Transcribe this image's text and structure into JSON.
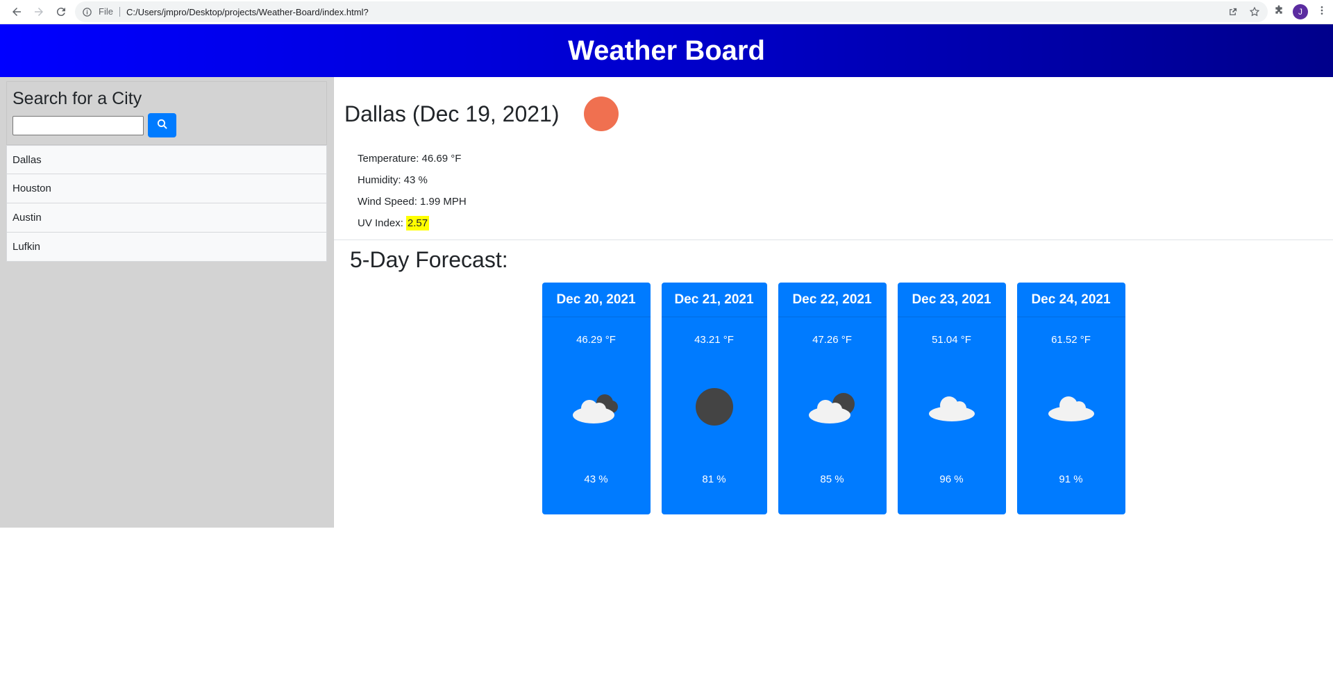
{
  "browser": {
    "file_label": "File",
    "url": "C:/Users/jmpro/Desktop/projects/Weather-Board/index.html?",
    "avatar_letter": "J"
  },
  "header": {
    "title": "Weather Board"
  },
  "sidebar": {
    "search_title": "Search for a City",
    "search_value": "",
    "cities": [
      {
        "name": "Dallas"
      },
      {
        "name": "Houston"
      },
      {
        "name": "Austin"
      },
      {
        "name": "Lufkin"
      }
    ]
  },
  "current": {
    "title": "Dallas (Dec 19, 2021)",
    "icon": "sun-icon",
    "temperature": "Temperature: 46.69 °F",
    "humidity": "Humidity: 43 %",
    "wind": "Wind Speed: 1.99 MPH",
    "uv_label": "UV Index:",
    "uv_value": "2.57"
  },
  "forecast": {
    "title": "5-Day Forecast:",
    "days": [
      {
        "date": "Dec 20, 2021",
        "temp": "46.29 °F",
        "icon": "partly-cloudy-icon",
        "humidity": "43 %"
      },
      {
        "date": "Dec 21, 2021",
        "temp": "43.21 °F",
        "icon": "overcast-icon",
        "humidity": "81 %"
      },
      {
        "date": "Dec 22, 2021",
        "temp": "47.26 °F",
        "icon": "partly-cloudy-icon",
        "humidity": "85 %"
      },
      {
        "date": "Dec 23, 2021",
        "temp": "51.04 °F",
        "icon": "cloud-icon",
        "humidity": "96 %"
      },
      {
        "date": "Dec 24, 2021",
        "temp": "61.52 °F",
        "icon": "cloud-icon",
        "humidity": "91 %"
      }
    ]
  },
  "colors": {
    "header_gradient_start": "#0000ff",
    "header_gradient_end": "#00008b",
    "card_bg": "#007bff",
    "uv_highlight": "#ffff00",
    "sun": "#f07050"
  }
}
